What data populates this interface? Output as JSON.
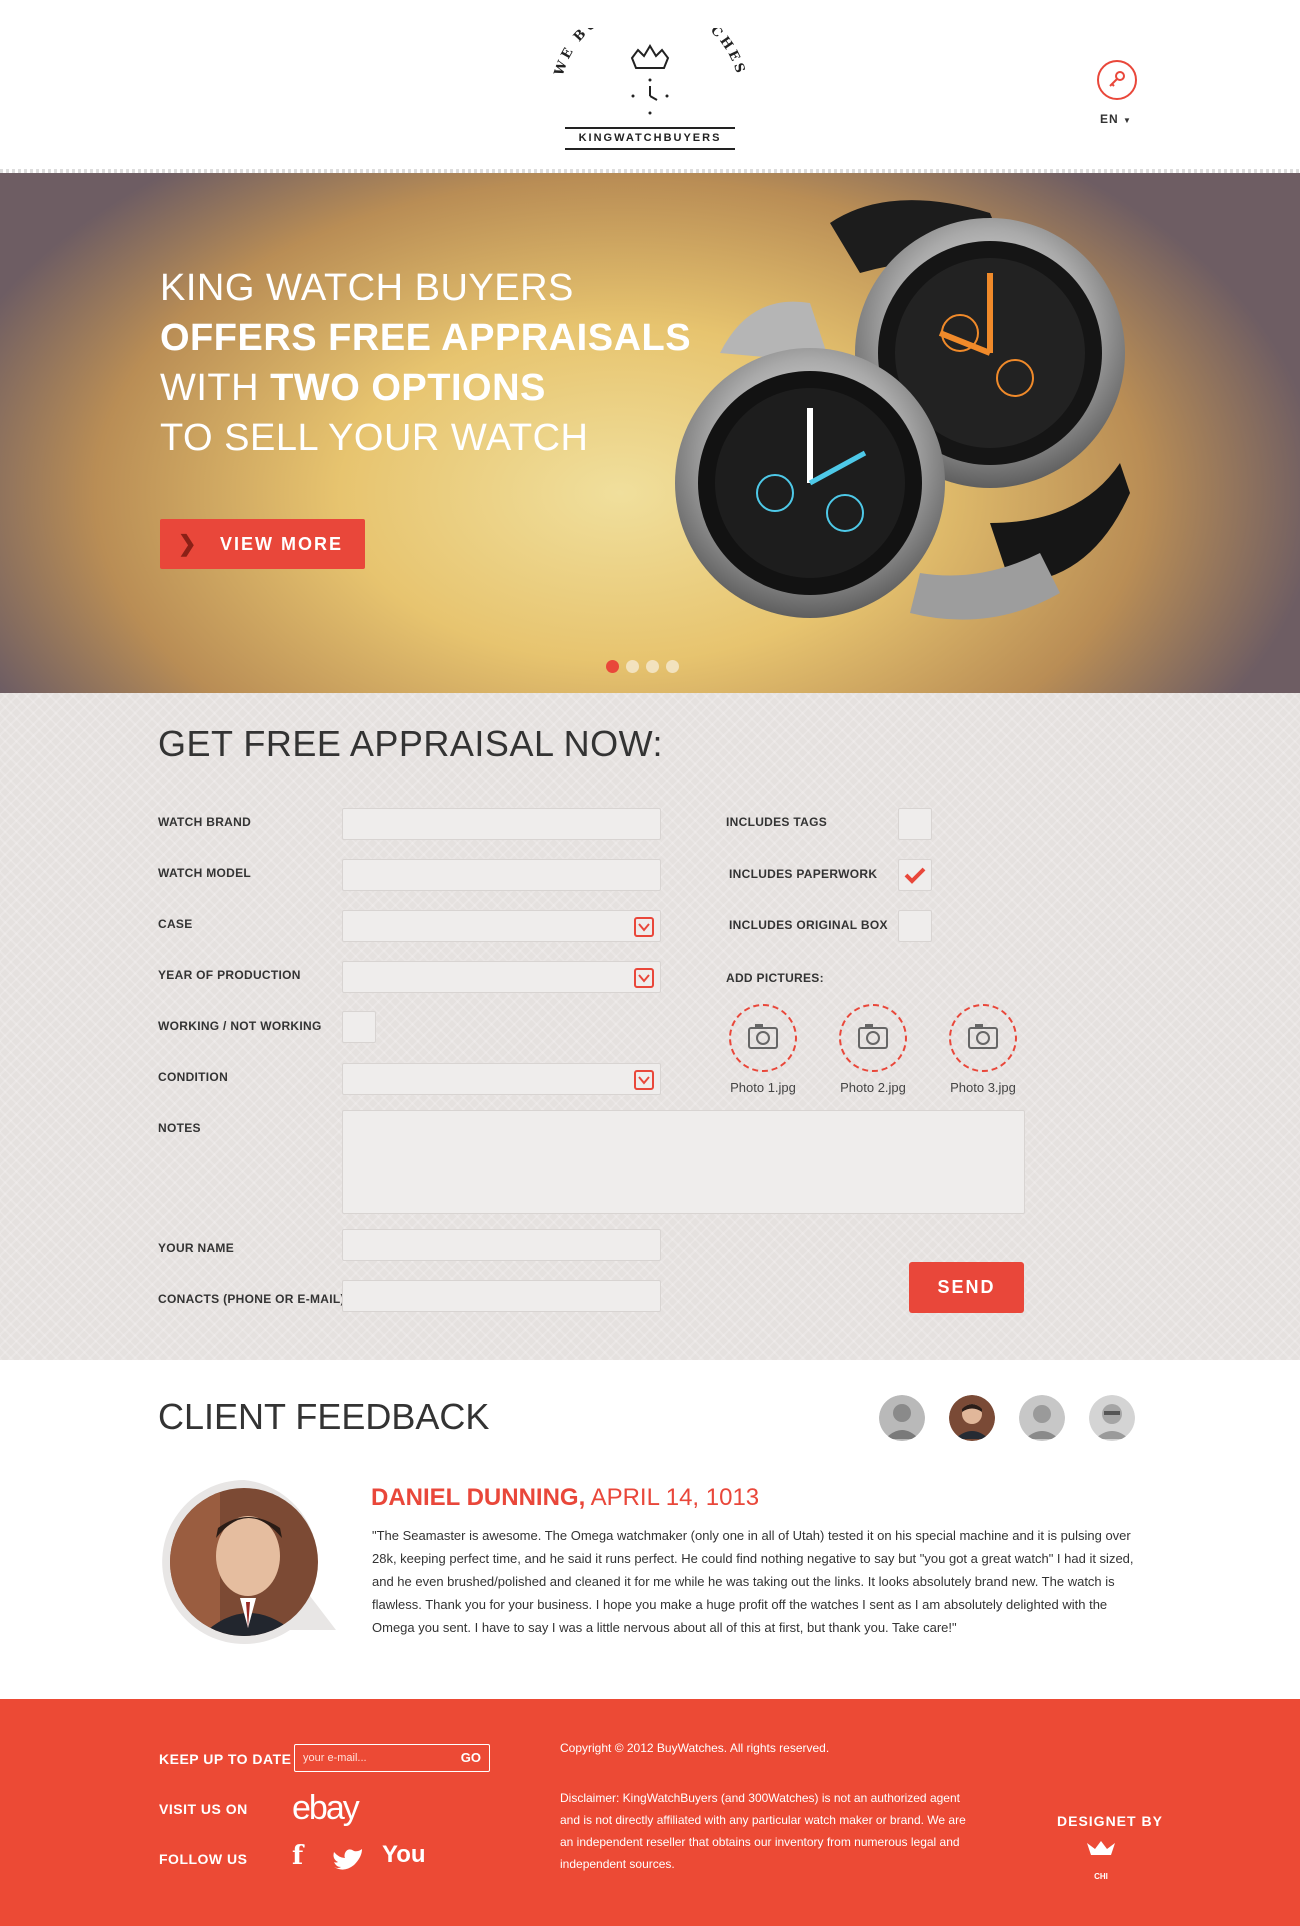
{
  "header": {
    "logo_arc_text": "WE BUY FINE WATCHES",
    "logo_bar_text": "KINGWATCHBUYERS",
    "lang": "EN",
    "accent": "#e9473a"
  },
  "hero": {
    "line1": "KING WATCH BUYERS",
    "line2": "OFFERS FREE APPRAISALS",
    "line3_prefix": "WITH ",
    "line3_bold": "TWO OPTIONS",
    "line4": "TO SELL YOUR WATCH",
    "button_label": "VIEW MORE",
    "slides_total": 4,
    "slide_active": 1
  },
  "form": {
    "title": "GET FREE APPRAISAL NOW:",
    "watch_brand": "WATCH BRAND",
    "watch_model": "WATCH MODEL",
    "case": "CASE",
    "year": "YEAR OF PRODUCTION",
    "working": "WORKING / NOT WORKING",
    "condition": "CONDITION",
    "notes": "NOTES",
    "your_name": "YOUR NAME",
    "contacts": "CONACTS (PHONE OR E-MAIL)",
    "includes_tags": "INCLUDES TAGS",
    "includes_paperwork": "INCLUDES PAPERWORK",
    "includes_box": "INCLUDES ORIGINAL BOX",
    "add_pictures": "ADD PICTURES:",
    "photos": [
      "Photo 1.jpg",
      "Photo 2.jpg",
      "Photo 3.jpg"
    ],
    "paperwork_checked": true,
    "send": "SEND"
  },
  "feedback": {
    "title": "CLIENT FEEDBACK",
    "name": "DANIEL DUNNING,",
    "date": " APRIL 14, 1013",
    "text": "\"The Seamaster is awesome. The Omega watchmaker (only one in all of Utah) tested it on his special machine and it is pulsing over 28k, keeping perfect time, and he said it runs perfect. He could find nothing negative to say but \"you got a great watch\" I had it sized, and he even brushed/polished and cleaned it for me while he was taking out the links. It looks absolutely brand new. The watch is flawless. Thank you for your business. I hope you make a huge profit off the watches I sent as I am absolutely delighted with the Omega you sent. I have to say I was a little nervous about all of this at first, but thank you. Take care!\"",
    "avatars_total": 4,
    "avatar_active": 2
  },
  "footer": {
    "keep_up": "KEEP UP TO DATE",
    "email_placeholder": "your e-mail...",
    "go": "GO",
    "visit": "VISIT US ON",
    "ebay": "ebay",
    "follow": "FOLLOW US",
    "facebook": "f",
    "youtube": "You",
    "copyright": "Copyright © 2012 BuyWatches. All rights reserved.",
    "disclaimer": "Disclaimer: KingWatchBuyers (and 300Watches) is not an authorized agent and is not directly affiliated with any particular watch maker or brand. We are an independent reseller that obtains our inventory from numerous legal and independent sources.",
    "designed_by": "DESIGNET BY",
    "designer_mark": "CHI",
    "bg": "#ec4a35"
  }
}
